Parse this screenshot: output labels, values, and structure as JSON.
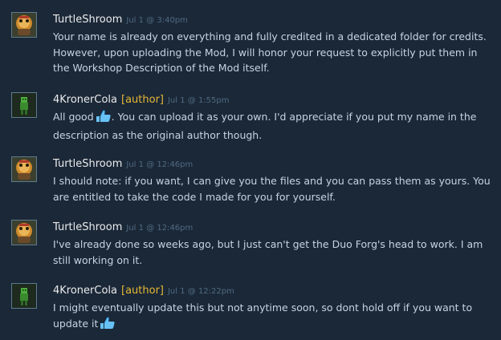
{
  "comments": [
    {
      "author": "TurtleShroom",
      "tag": "",
      "time": "Jul 1 @ 3:40pm",
      "avatar": "turtle-avatar",
      "text": "Your name is already on everything and fully credited in a dedicated folder for credits. However, upon uploading the Mod, I will honor your request to explicitly put them in the Workshop Description of the Mod itself.",
      "text_after": "",
      "emote": ""
    },
    {
      "author": "4KronerCola",
      "tag": "[author]",
      "time": "Jul 1 @ 1:55pm",
      "avatar": "green-figure-avatar",
      "text": "All good",
      "text_after": ". You can upload it as your own. I'd appreciate if you put my name in the description as the original author though.",
      "emote": "thumbs-up-icon"
    },
    {
      "author": "TurtleShroom",
      "tag": "",
      "time": "Jul 1 @ 12:46pm",
      "avatar": "turtle-avatar",
      "text": "I should note: if you want, I can give you the files and you can pass them as yours. You are entitled to take the code I made for you for yourself.",
      "text_after": "",
      "emote": ""
    },
    {
      "author": "TurtleShroom",
      "tag": "",
      "time": "Jul 1 @ 12:46pm",
      "avatar": "turtle-avatar",
      "text": "I've already done so weeks ago, but I just can't get the Duo Forg's head to work. I am still working on it.",
      "text_after": "",
      "emote": ""
    },
    {
      "author": "4KronerCola",
      "tag": "[author]",
      "time": "Jul 1 @ 12:22pm",
      "avatar": "green-figure-avatar",
      "text": "I might eventually update this but not anytime soon, so dont hold off if you want to update it",
      "text_after": "",
      "emote": "thumbs-up-icon"
    }
  ],
  "colors": {
    "background": "#1b2838",
    "author_name": "#ebebeb",
    "author_tag": "#e5b733",
    "timestamp": "#4f6b81",
    "body_text": "#c6d4df",
    "emote_blue": "#67c1f5"
  }
}
